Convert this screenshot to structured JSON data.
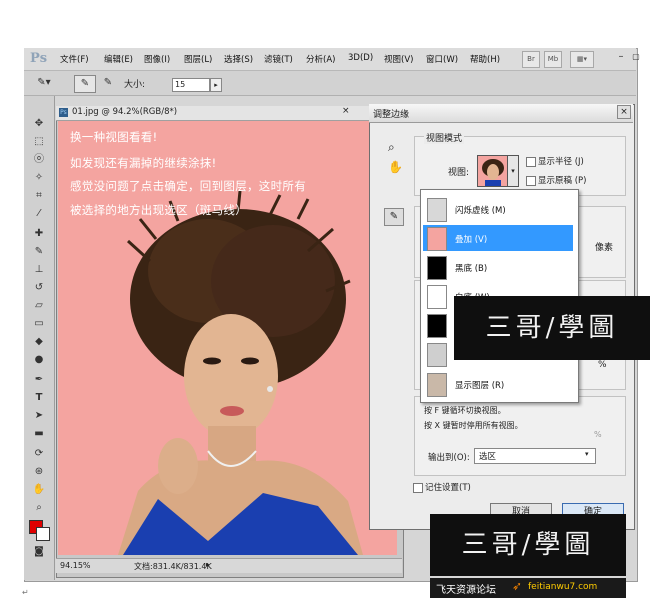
{
  "menubar": {
    "logo": "Ps",
    "items": [
      "文件(F)",
      "编辑(E)",
      "图像(I)",
      "图层(L)",
      "选择(S)",
      "滤镜(T)",
      "分析(A)",
      "3D(D)",
      "视图(V)",
      "窗口(W)",
      "帮助(H)"
    ],
    "buttons": [
      "Br",
      "Mb"
    ]
  },
  "optionsbar": {
    "size_label": "大小:",
    "size_value": "15"
  },
  "document": {
    "tab_title": "01.jpg @ 94.2%(RGB/8*)",
    "zoom": "94.15%",
    "doc_info": "文档:831.4K/831.4K"
  },
  "canvas_text": {
    "line1": "换一种视图看看!",
    "line2": "如发现还有漏掉的继续涂抹!",
    "line3": "感觉没问题了点击确定，回到图层，这时所有",
    "line4": "被选择的地方出现选区（斑马线）"
  },
  "dialog": {
    "title": "调整边缘",
    "view_mode_label": "视图模式",
    "view_label": "视图:",
    "show_radius": "显示半径 (J)",
    "show_original": "显示原稿 (P)",
    "side_label_px": "像素",
    "side_label_pct": "%",
    "output_to_label": "输出到(O):",
    "output_to_value": "选区",
    "remember": "记住设置(T)",
    "cancel": "取消",
    "ok": "确定"
  },
  "viewlist": {
    "items": [
      "闪烁虚线 (M)",
      "叠加 (V)",
      "黑底 (B)",
      "白底 (W)",
      "",
      "",
      "显示图层 (R)"
    ],
    "selected_index": 1,
    "hint1": "按 F 键循环切换视图。",
    "hint2": "按 X 键暂时停用所有视图。"
  },
  "watermarks": {
    "text": "三哥/學圖",
    "footer_site": "飞天资源论坛",
    "footer_url": "feitianwu7.com"
  },
  "colors": {
    "canvas": "#f4a4a0",
    "selection_blue": "#3399ff",
    "foreground": "#e00000",
    "background": "#ffffff"
  }
}
